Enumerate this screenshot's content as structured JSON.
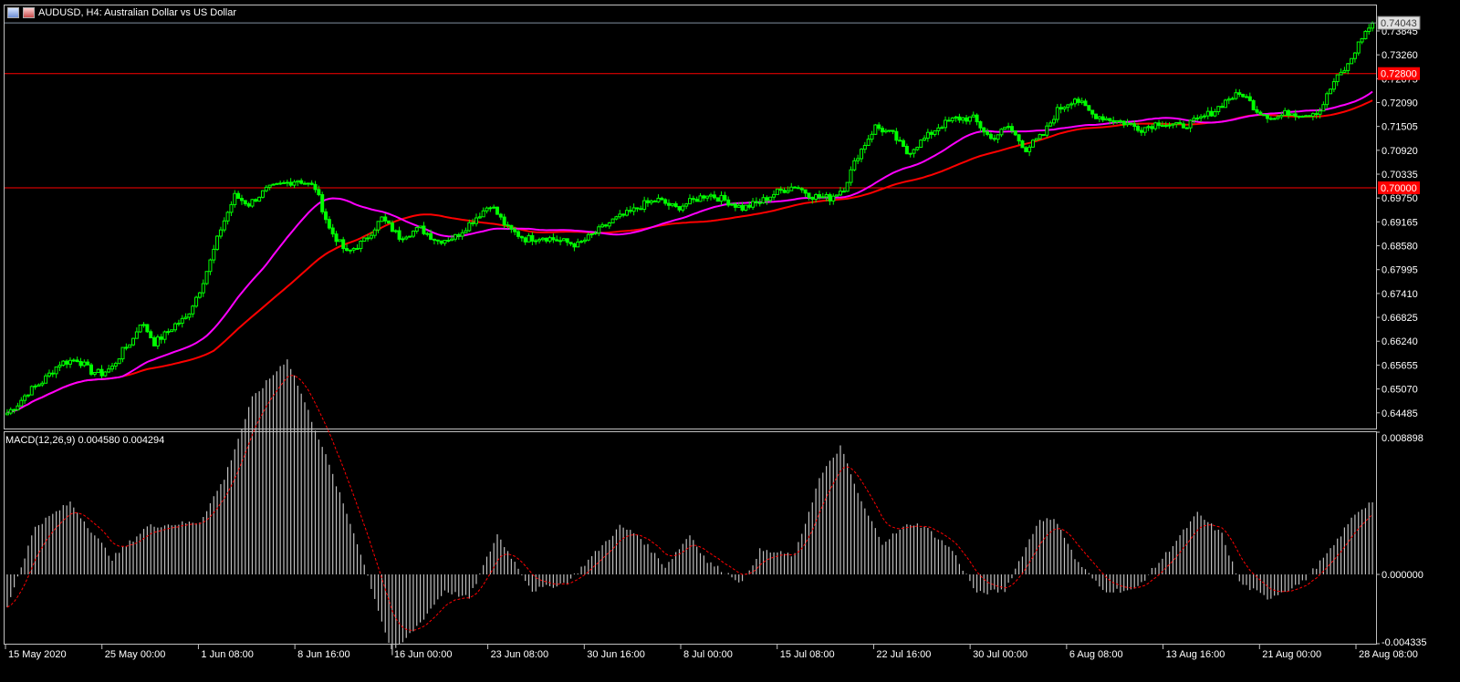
{
  "window": {
    "title": "AUDUSD, H4:  Australian Dollar vs US Dollar",
    "icons": [
      "chart-window-icon",
      "chart-properties-icon"
    ]
  },
  "colors": {
    "background": "#000000",
    "candle": "#00ff00",
    "ma_fast": "#ff00ff",
    "ma_slow": "#ff0000",
    "level_line": "#ff0000",
    "grid_axis": "#c0c0c0",
    "macd_hist": "#c0c0c0",
    "macd_signal": "#ff0000"
  },
  "chart_data": [
    {
      "type": "candlestick",
      "title": "AUDUSD, H4:  Australian Dollar vs US Dollar",
      "symbol": "AUDUSD",
      "timeframe": "H4",
      "grid": false,
      "y_axis_ticks": [
        "0.73845",
        "0.73260",
        "0.72675",
        "0.72090",
        "0.71505",
        "0.70920",
        "0.70335",
        "0.69750",
        "0.69165",
        "0.68580",
        "0.67995",
        "0.67410",
        "0.66825",
        "0.66240",
        "0.65655",
        "0.65070",
        "0.64485"
      ],
      "y_axis_values": [
        0.73845,
        0.7326,
        0.72675,
        0.7209,
        0.71505,
        0.7092,
        0.70335,
        0.6975,
        0.69165,
        0.6858,
        0.67995,
        0.6741,
        0.66825,
        0.6624,
        0.65655,
        0.6507,
        0.64485
      ],
      "ylim": [
        0.641,
        0.7447
      ],
      "current_price_label": "0.74043",
      "current_price": 0.74043,
      "horizontal_levels": [
        {
          "price": 0.728,
          "label": "0.72800"
        },
        {
          "price": 0.7,
          "label": "0.70000"
        }
      ],
      "x_axis_labels": [
        "15 May 2020",
        "25 May 00:00",
        "1 Jun 08:00",
        "8 Jun 16:00",
        "16 Jun 00:00",
        "23 Jun 08:00",
        "30 Jun 16:00",
        "8 Jul 00:00",
        "15 Jul 08:00",
        "22 Jul 16:00",
        "30 Jul 00:00",
        "6 Aug 08:00",
        "13 Aug 16:00",
        "21 Aug 00:00",
        "28 Aug 08:00"
      ],
      "close_series": {
        "name": "AUDUSD close",
        "x_index": [
          0,
          3,
          6,
          10,
          15,
          20,
          24,
          27,
          30,
          33,
          36,
          38,
          40,
          42,
          45,
          48,
          51,
          55,
          58,
          61,
          65,
          69,
          74,
          79,
          83,
          88,
          92,
          97,
          102,
          107,
          112,
          118,
          123,
          128,
          133,
          138,
          143,
          148,
          153,
          158,
          163,
          168,
          173,
          178,
          182,
          186,
          191,
          195,
          200,
          205,
          210,
          215,
          220,
          225,
          230,
          235,
          239,
          243,
          248,
          253,
          257,
          262,
          266,
          271,
          276,
          281,
          286,
          291,
          296,
          300,
          305,
          310,
          314,
          319,
          324,
          329,
          335,
          340,
          345,
          349,
          353,
          357,
          362,
          366,
          371,
          375,
          379,
          383,
          387,
          390
        ],
        "price": [
          0.6448,
          0.647,
          0.65,
          0.6525,
          0.657,
          0.658,
          0.655,
          0.6545,
          0.656,
          0.66,
          0.663,
          0.667,
          0.665,
          0.662,
          0.664,
          0.6665,
          0.668,
          0.675,
          0.682,
          0.69,
          0.698,
          0.696,
          0.6995,
          0.701,
          0.702,
          0.7,
          0.69,
          0.684,
          0.687,
          0.6925,
          0.688,
          0.69,
          0.687,
          0.688,
          0.692,
          0.696,
          0.69,
          0.6875,
          0.688,
          0.687,
          0.686,
          0.689,
          0.692,
          0.694,
          0.696,
          0.697,
          0.695,
          0.6965,
          0.6985,
          0.697,
          0.695,
          0.6965,
          0.699,
          0.7005,
          0.698,
          0.6975,
          0.7,
          0.708,
          0.715,
          0.713,
          0.7085,
          0.712,
          0.715,
          0.717,
          0.717,
          0.712,
          0.715,
          0.7095,
          0.713,
          0.719,
          0.722,
          0.718,
          0.717,
          0.716,
          0.7145,
          0.716,
          0.715,
          0.7165,
          0.719,
          0.722,
          0.723,
          0.719,
          0.717,
          0.7185,
          0.718,
          0.719,
          0.726,
          0.73,
          0.737,
          0.7404
        ]
      }
    },
    {
      "type": "bar",
      "title": "MACD(12,26,9) 0.004580 0.004294",
      "indicator": "MACD",
      "params": "12,26,9",
      "macd_value": 0.00458,
      "signal_value": 0.004294,
      "y_axis_ticks": [
        "0.008898",
        "0.000000",
        "-0.004335"
      ],
      "ylim": [
        -0.004335,
        0.008898
      ],
      "histogram_keypoints": {
        "x_index": [
          0,
          8,
          18,
          30,
          40,
          55,
          62,
          70,
          80,
          90,
          95,
          100,
          110,
          118,
          125,
          132,
          140,
          150,
          160,
          170,
          175,
          180,
          188,
          195,
          200,
          210,
          215,
          225,
          232,
          238,
          244,
          250,
          258,
          262,
          270,
          277,
          285,
          295,
          300,
          305,
          313,
          322,
          330,
          340,
          347,
          352,
          360,
          370,
          378,
          385,
          390
        ],
        "value": [
          -0.002,
          0.003,
          0.0045,
          0.001,
          0.003,
          0.0033,
          0.006,
          0.011,
          0.0135,
          0.008,
          0.005,
          0.002,
          -0.005,
          -0.003,
          -0.001,
          -0.0015,
          0.0025,
          -0.001,
          -0.0005,
          0.0018,
          0.003,
          0.0025,
          0.0005,
          0.0025,
          0.0008,
          -0.0005,
          0.0015,
          0.0012,
          0.006,
          0.008,
          0.0045,
          0.002,
          0.0032,
          0.003,
          0.0015,
          -0.0012,
          -0.001,
          0.0035,
          0.0033,
          0.001,
          -0.001,
          -0.001,
          0.001,
          0.0038,
          0.0025,
          -0.0005,
          -0.0015,
          -0.0005,
          0.0015,
          0.0038,
          0.0046
        ]
      }
    }
  ]
}
